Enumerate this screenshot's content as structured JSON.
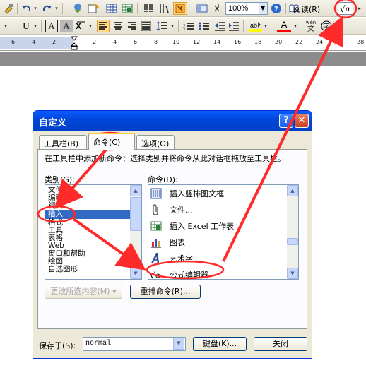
{
  "toolbar1": {
    "zoom_value": "100%",
    "read_label": "阅读",
    "read_shortcut": "(R)"
  },
  "toolbar2": {
    "underline_label": "U",
    "char_border_label": "A",
    "char_shade_label": "A",
    "font_color_label": "A",
    "wen_label": "wén",
    "wen_char": "文"
  },
  "ruler": {
    "ticks": [
      "6",
      "4",
      "2",
      "2",
      "4",
      "6",
      "8",
      "10",
      "12",
      "14",
      "16",
      "18",
      "20",
      "22",
      "24",
      "26",
      "28"
    ]
  },
  "dialog": {
    "title": "自定义",
    "help_glyph": "?",
    "close_glyph": "✕",
    "tabs": [
      {
        "label": "工具栏(B)"
      },
      {
        "label": "命令(C)"
      },
      {
        "label": "选项(O)"
      }
    ],
    "description": "在工具栏中添加新命令：选择类别并将命令从此对话框拖放至工具栏。",
    "categories_label": "类别(G):",
    "commands_label": "命令(D):",
    "categories": [
      "文件",
      "编辑",
      "视图",
      "插入",
      "格式",
      "工具",
      "表格",
      "Web",
      "窗口和帮助",
      "绘图",
      "自选图形"
    ],
    "selected_category": "插入",
    "commands": [
      {
        "icon": "vertical-textbox-icon",
        "label": "插入竖排图文框"
      },
      {
        "icon": "paperclip-icon",
        "label": "文件..."
      },
      {
        "icon": "excel-icon",
        "label": "插入 Excel 工作表"
      },
      {
        "icon": "chart-icon",
        "label": "图表"
      },
      {
        "icon": "wordart-icon",
        "label": "艺术字..."
      },
      {
        "icon": "equation-icon",
        "label": "公式编辑器"
      }
    ],
    "modify_selection_label": "更改所选内容(M) ▾",
    "rearrange_label": "重排命令(R)...",
    "save_in_label": "保存于(S):",
    "save_in_value": "normal",
    "keyboard_label": "键盘(K)...",
    "close_label": "关闭"
  },
  "colors": {
    "accent": "#316ac5",
    "annotation": "#ff0000",
    "title_bar": "#0a5bff"
  }
}
